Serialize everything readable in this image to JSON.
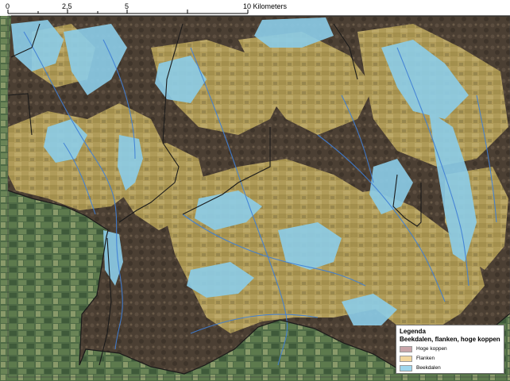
{
  "scale_bar": {
    "ticks": [
      "0",
      "2,5",
      "5",
      "10 Kilometers"
    ]
  },
  "legend": {
    "title": "Legenda",
    "subtitle": "Beekdalen, flanken, hoge koppen",
    "items": [
      {
        "label": "Hoge koppen",
        "color": "#c9a5a9"
      },
      {
        "label": "Flanken",
        "color": "#f2d79e"
      },
      {
        "label": "Beekdalen",
        "color": "#9fd7ee"
      }
    ]
  },
  "colors": {
    "dark_terrain": "#4f4235",
    "flank_overlay": "#b6a15e",
    "valley_overlay": "#8ccde9",
    "outside_green": "#4e6a45",
    "boundary_line": "#1a1a1a",
    "stream_line": "#3f7fd6"
  }
}
